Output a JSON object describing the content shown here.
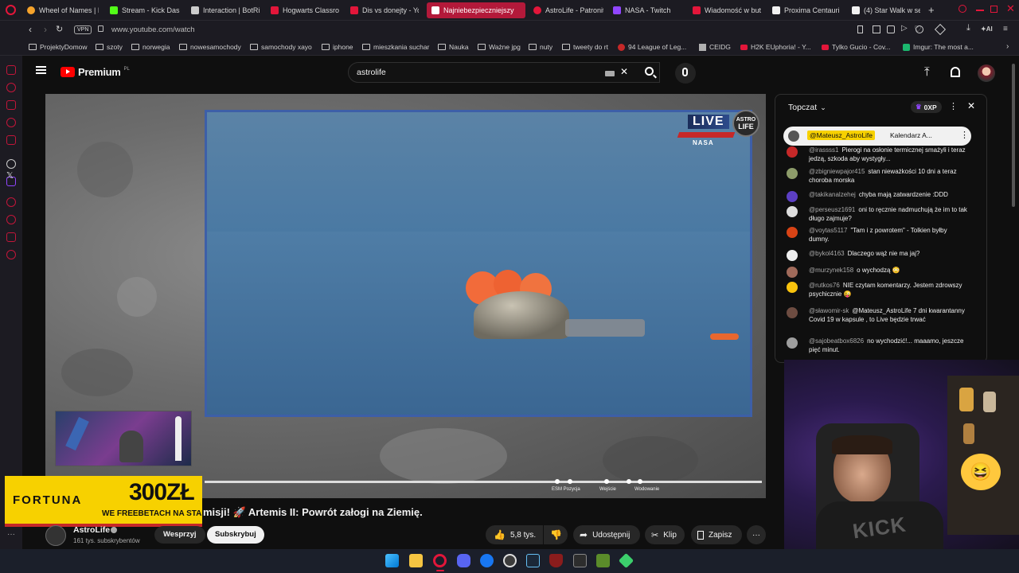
{
  "browser": {
    "tabs": [
      {
        "label": "Wheel of Names | F",
        "color": "#f6a32b"
      },
      {
        "label": "Stream - Kick Dash",
        "color": "#53fc18"
      },
      {
        "label": "Interaction | BotRix",
        "color": "#cccccc"
      },
      {
        "label": "Hogwarts Classroo",
        "color": "#e3163a"
      },
      {
        "label": "Dis vs donejty - Yo",
        "color": "#e3163a"
      },
      {
        "label": "Najniebezpieczniejszy",
        "color": "#ffffff",
        "active": true
      },
      {
        "label": "AstroLife - Patronit",
        "color": "#e3163a"
      },
      {
        "label": "NASA - Twitch",
        "color": "#9146ff"
      },
      {
        "label": "Wiadomość w bute",
        "color": "#e3163a"
      },
      {
        "label": "Proxima Centauri b",
        "color": "#f1f1f1"
      },
      {
        "label": "(4) Star Walk w se",
        "color": "#f1f1f1"
      }
    ],
    "url": "www.youtube.com/watch",
    "vpn_label": "VPN",
    "bookmarks": [
      "ProjektyDomow",
      "szoty",
      "norwegia",
      "nowesamochody",
      "samochody xayo",
      "iphone",
      "mieszkania suchar",
      "Nauka",
      "Ważne jpg",
      "nuty",
      "tweety do rt",
      "94 League of Leg...",
      "CEIDG",
      "H2K EUphoria! - Y...",
      "Tylko Gucio - Cov...",
      "Imgur: The most a..."
    ]
  },
  "youtube": {
    "logo": "Premium",
    "logo_region": "PL",
    "search_value": "astrolife",
    "video": {
      "live_badge": "LIVE",
      "brand_top": "ASTRO",
      "brand_bottom": "LIFE",
      "nasa_label": "NASA",
      "title": "misji! 🚀 Artemis II: Powrót załogi na Ziemię.",
      "chapters": [
        "ESM Pozycja",
        "Wejście",
        "Wodowanie"
      ],
      "sponsor_brand": "FORTUNA",
      "sponsor_amount": "300ZŁ",
      "sponsor_line1": "WE FREEBETACH NA START"
    },
    "channel": {
      "name": "AstroLife",
      "subs": "161 tys. subskrybentów",
      "support_label": "Wesprzyj",
      "subscribe_label": "Subskrybuj"
    },
    "actions": {
      "likes": "5,8 tys.",
      "share": "Udostępnij",
      "clip": "Klip",
      "save": "Zapisz"
    },
    "chat": {
      "header": "Topczat",
      "xp": "0XP",
      "pinned_user": "@Mateusz_AstroLife",
      "pinned_text": "Kalendarz A...",
      "messages": [
        {
          "user": "@irassss1",
          "text": "Pierogi na osłonie termicznej smażyli i teraz jedzą, szkoda aby wystygły...",
          "color": "#c62828"
        },
        {
          "user": "@zbigniewpajor415",
          "text": "stan nieważkości 10 dni a teraz choroba morska",
          "color": "#8d9c6a"
        },
        {
          "user": "@takikanalzehej",
          "text": "chyba mają zatwardzenie :DDD",
          "color": "#5c3fc4"
        },
        {
          "user": "@perseusz1691",
          "text": "oni to ręcznie nadmuchują że im to tak długo zajmuje?",
          "color": "#dddddd"
        },
        {
          "user": "@voytas5117",
          "text": "\"Tam i z powrotem\" - Tolkien byłby dumny.",
          "color": "#d84315"
        },
        {
          "user": "@bykol4163",
          "text": "Dlaczego wąż nie ma jaj?",
          "color": "#eeeeee"
        },
        {
          "user": "@murzynek158",
          "text": "o wychodzą 😳",
          "color": "#a06a5a"
        },
        {
          "user": "@rutkos76",
          "text": "NIE czytam komentarzy. Jestem zdrowszy psychicznie 😜",
          "color": "#f9c30d"
        },
        {
          "user": "@sławomir-sk",
          "text": "@Mateusz_AstroLife 7 dni kwarantanny Covid 19 w kapsule , to Live będzie trwać",
          "color": "#6d4c41"
        },
        {
          "user": "@sajobeatbox6826",
          "text": "no wychodzić!... maaamo, jeszcze pięć minut.",
          "color": "#9e9e9e"
        }
      ]
    }
  },
  "kick": {
    "logo": "KICK"
  }
}
